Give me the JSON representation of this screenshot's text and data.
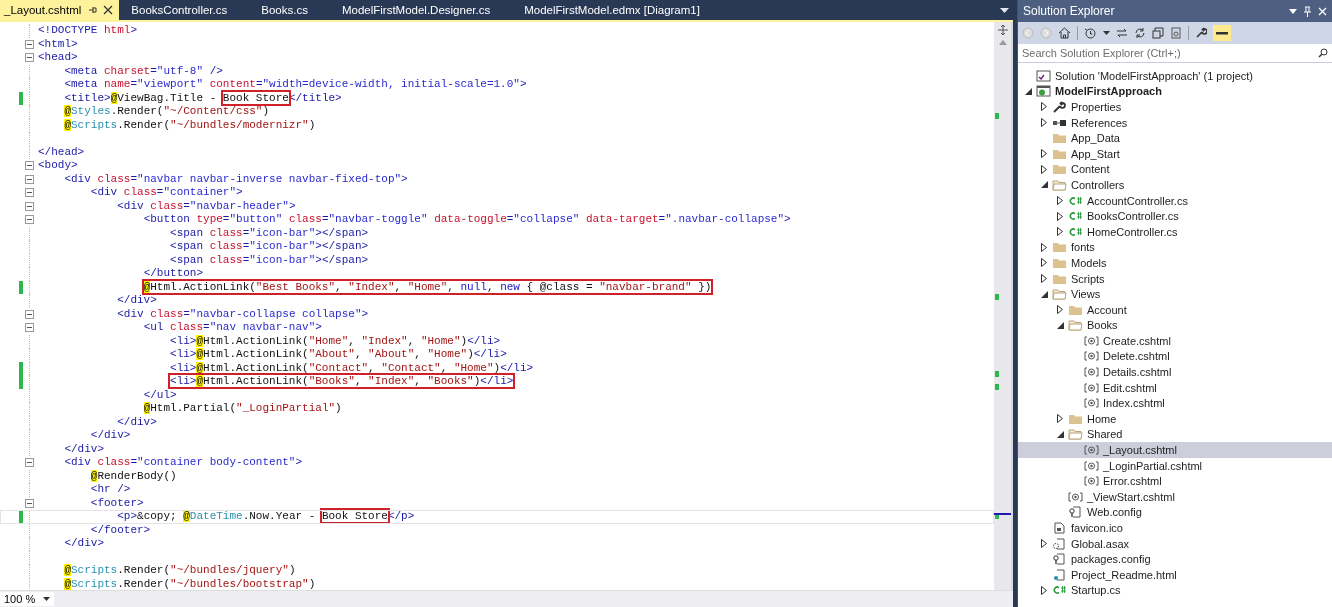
{
  "editor": {
    "tabs": [
      {
        "label": "_Layout.cshtml",
        "selected": true
      },
      {
        "label": "BooksController.cs",
        "selected": false
      },
      {
        "label": "Books.cs",
        "selected": false
      },
      {
        "label": "ModelFirstModel.Designer.cs",
        "selected": false
      },
      {
        "label": "ModelFirstModel.edmx [Diagram1]",
        "selected": false
      }
    ],
    "lines": [
      {
        "fold": false,
        "changed": false,
        "current": false,
        "segs": [
          {
            "kind": "tag",
            "text": "<!DOCTYPE "
          },
          {
            "kind": "attr",
            "text": "html"
          },
          {
            "kind": "tag",
            "text": ">"
          }
        ]
      },
      {
        "fold": true,
        "changed": false,
        "current": false,
        "segs": [
          {
            "kind": "tag",
            "text": "<html>"
          }
        ]
      },
      {
        "fold": true,
        "changed": false,
        "current": false,
        "segs": [
          {
            "kind": "tag",
            "text": "<head>"
          }
        ]
      },
      {
        "fold": false,
        "changed": false,
        "current": false,
        "segs": [
          {
            "kind": "tag",
            "text": "    <meta "
          },
          {
            "kind": "attr",
            "text": "charset"
          },
          {
            "kind": "tag",
            "text": "="
          },
          {
            "kind": "val",
            "text": "\"utf-8\""
          },
          {
            "kind": "tag",
            "text": " />"
          }
        ]
      },
      {
        "fold": false,
        "changed": false,
        "current": false,
        "segs": [
          {
            "kind": "tag",
            "text": "    <meta "
          },
          {
            "kind": "attr",
            "text": "name"
          },
          {
            "kind": "tag",
            "text": "="
          },
          {
            "kind": "val",
            "text": "\"viewport\" "
          },
          {
            "kind": "attr",
            "text": "content"
          },
          {
            "kind": "tag",
            "text": "="
          },
          {
            "kind": "val",
            "text": "\"width=device-width, initial-scale=1.0\""
          },
          {
            "kind": "tag",
            "text": ">"
          }
        ]
      },
      {
        "fold": false,
        "changed": true,
        "current": false,
        "segs": [
          {
            "kind": "tag",
            "text": "    <title>"
          },
          {
            "kind": "at",
            "text": "@"
          },
          {
            "kind": "plain",
            "text": "ViewBag.Title - "
          },
          {
            "kind": "boxed",
            "segs": [
              {
                "kind": "plain",
                "text": "Book Store"
              }
            ]
          },
          {
            "kind": "tag",
            "text": "</title>"
          }
        ]
      },
      {
        "fold": false,
        "changed": false,
        "current": false,
        "segs": [
          {
            "kind": "at",
            "text": "    @"
          },
          {
            "kind": "type",
            "text": "Styles"
          },
          {
            "kind": "plain",
            "text": ".Render("
          },
          {
            "kind": "str",
            "text": "\"~/Content/css\""
          },
          {
            "kind": "plain",
            "text": ")"
          }
        ]
      },
      {
        "fold": false,
        "changed": false,
        "current": false,
        "segs": [
          {
            "kind": "at",
            "text": "    @"
          },
          {
            "kind": "type",
            "text": "Scripts"
          },
          {
            "kind": "plain",
            "text": ".Render("
          },
          {
            "kind": "str",
            "text": "\"~/bundles/modernizr\""
          },
          {
            "kind": "plain",
            "text": ")"
          }
        ]
      },
      {
        "fold": false,
        "changed": false,
        "current": false
      },
      {
        "fold": false,
        "changed": false,
        "current": false,
        "segs": [
          {
            "kind": "tag",
            "text": "</head>"
          }
        ]
      },
      {
        "fold": true,
        "changed": false,
        "current": false,
        "segs": [
          {
            "kind": "tag",
            "text": "<body>"
          }
        ]
      },
      {
        "fold": true,
        "changed": false,
        "current": false,
        "segs": [
          {
            "kind": "tag",
            "text": "    <div "
          },
          {
            "kind": "attr",
            "text": "class"
          },
          {
            "kind": "tag",
            "text": "="
          },
          {
            "kind": "val",
            "text": "\"navbar navbar-inverse navbar-fixed-top\""
          },
          {
            "kind": "tag",
            "text": ">"
          }
        ]
      },
      {
        "fold": true,
        "changed": false,
        "current": false,
        "segs": [
          {
            "kind": "tag",
            "text": "        <div "
          },
          {
            "kind": "attr",
            "text": "class"
          },
          {
            "kind": "tag",
            "text": "="
          },
          {
            "kind": "val",
            "text": "\"container\""
          },
          {
            "kind": "tag",
            "text": ">"
          }
        ]
      },
      {
        "fold": true,
        "changed": false,
        "current": false,
        "segs": [
          {
            "kind": "tag",
            "text": "            <div "
          },
          {
            "kind": "attr",
            "text": "class"
          },
          {
            "kind": "tag",
            "text": "="
          },
          {
            "kind": "val",
            "text": "\"navbar-header\""
          },
          {
            "kind": "tag",
            "text": ">"
          }
        ]
      },
      {
        "fold": true,
        "changed": false,
        "current": false,
        "segs": [
          {
            "kind": "tag",
            "text": "                <button "
          },
          {
            "kind": "attr",
            "text": "type"
          },
          {
            "kind": "tag",
            "text": "="
          },
          {
            "kind": "val",
            "text": "\"button\" "
          },
          {
            "kind": "attr",
            "text": "class"
          },
          {
            "kind": "tag",
            "text": "="
          },
          {
            "kind": "val",
            "text": "\"navbar-toggle\" "
          },
          {
            "kind": "attr",
            "text": "data-toggle"
          },
          {
            "kind": "tag",
            "text": "="
          },
          {
            "kind": "val",
            "text": "\"collapse\" "
          },
          {
            "kind": "attr",
            "text": "data-target"
          },
          {
            "kind": "tag",
            "text": "="
          },
          {
            "kind": "val",
            "text": "\".navbar-collapse\""
          },
          {
            "kind": "tag",
            "text": ">"
          }
        ]
      },
      {
        "fold": false,
        "changed": false,
        "current": false,
        "segs": [
          {
            "kind": "tag",
            "text": "                    <span "
          },
          {
            "kind": "attr",
            "text": "class"
          },
          {
            "kind": "tag",
            "text": "="
          },
          {
            "kind": "val",
            "text": "\"icon-bar\""
          },
          {
            "kind": "tag",
            "text": "></span>"
          }
        ]
      },
      {
        "fold": false,
        "changed": false,
        "current": false,
        "segs": [
          {
            "kind": "tag",
            "text": "                    <span "
          },
          {
            "kind": "attr",
            "text": "class"
          },
          {
            "kind": "tag",
            "text": "="
          },
          {
            "kind": "val",
            "text": "\"icon-bar\""
          },
          {
            "kind": "tag",
            "text": "></span>"
          }
        ]
      },
      {
        "fold": false,
        "changed": false,
        "current": false,
        "segs": [
          {
            "kind": "tag",
            "text": "                    <span "
          },
          {
            "kind": "attr",
            "text": "class"
          },
          {
            "kind": "tag",
            "text": "="
          },
          {
            "kind": "val",
            "text": "\"icon-bar\""
          },
          {
            "kind": "tag",
            "text": "></span>"
          }
        ]
      },
      {
        "fold": false,
        "changed": false,
        "current": false,
        "segs": [
          {
            "kind": "tag",
            "text": "                </button>"
          }
        ]
      },
      {
        "fold": false,
        "changed": true,
        "current": false,
        "segs": [
          {
            "kind": "boxed",
            "segs": [
              {
                "kind": "at",
                "text": "                @"
              },
              {
                "kind": "plain",
                "text": "Html.ActionLink("
              },
              {
                "kind": "str",
                "text": "\"Best Books\""
              },
              {
                "kind": "plain",
                "text": ", "
              },
              {
                "kind": "str",
                "text": "\"Index\""
              },
              {
                "kind": "plain",
                "text": ", "
              },
              {
                "kind": "str",
                "text": "\"Home\""
              },
              {
                "kind": "plain",
                "text": ", "
              },
              {
                "kind": "kw",
                "text": "null"
              },
              {
                "kind": "plain",
                "text": ", "
              },
              {
                "kind": "kw",
                "text": "new"
              },
              {
                "kind": "plain",
                "text": " { @class = "
              },
              {
                "kind": "str",
                "text": "\"navbar-brand\""
              },
              {
                "kind": "plain",
                "text": " })"
              }
            ]
          }
        ]
      },
      {
        "fold": false,
        "changed": false,
        "current": false,
        "segs": [
          {
            "kind": "tag",
            "text": "            </div>"
          }
        ]
      },
      {
        "fold": true,
        "changed": false,
        "current": false,
        "segs": [
          {
            "kind": "tag",
            "text": "            <div "
          },
          {
            "kind": "attr",
            "text": "class"
          },
          {
            "kind": "tag",
            "text": "="
          },
          {
            "kind": "val",
            "text": "\"navbar-collapse collapse\""
          },
          {
            "kind": "tag",
            "text": ">"
          }
        ]
      },
      {
        "fold": true,
        "changed": false,
        "current": false,
        "segs": [
          {
            "kind": "tag",
            "text": "                <ul "
          },
          {
            "kind": "attr",
            "text": "class"
          },
          {
            "kind": "tag",
            "text": "="
          },
          {
            "kind": "val",
            "text": "\"nav navbar-nav\""
          },
          {
            "kind": "tag",
            "text": ">"
          }
        ]
      },
      {
        "fold": false,
        "changed": false,
        "current": false,
        "segs": [
          {
            "kind": "tag",
            "text": "                    <li>"
          },
          {
            "kind": "at",
            "text": "@"
          },
          {
            "kind": "plain",
            "text": "Html.ActionLink("
          },
          {
            "kind": "str",
            "text": "\"Home\""
          },
          {
            "kind": "plain",
            "text": ", "
          },
          {
            "kind": "str",
            "text": "\"Index\""
          },
          {
            "kind": "plain",
            "text": ", "
          },
          {
            "kind": "str",
            "text": "\"Home\""
          },
          {
            "kind": "plain",
            "text": ")"
          },
          {
            "kind": "tag",
            "text": "</li>"
          }
        ]
      },
      {
        "fold": false,
        "changed": false,
        "current": false,
        "segs": [
          {
            "kind": "tag",
            "text": "                    <li>"
          },
          {
            "kind": "at",
            "text": "@"
          },
          {
            "kind": "plain",
            "text": "Html.ActionLink("
          },
          {
            "kind": "str",
            "text": "\"About\""
          },
          {
            "kind": "plain",
            "text": ", "
          },
          {
            "kind": "str",
            "text": "\"About\""
          },
          {
            "kind": "plain",
            "text": ", "
          },
          {
            "kind": "str",
            "text": "\"Home\""
          },
          {
            "kind": "plain",
            "text": ")"
          },
          {
            "kind": "tag",
            "text": "</li>"
          }
        ]
      },
      {
        "fold": false,
        "changed": true,
        "current": false,
        "segs": [
          {
            "kind": "tag",
            "text": "                    <li>"
          },
          {
            "kind": "at",
            "text": "@"
          },
          {
            "kind": "plain",
            "text": "Html.ActionLink("
          },
          {
            "kind": "str",
            "text": "\"Contact\""
          },
          {
            "kind": "plain",
            "text": ", "
          },
          {
            "kind": "str",
            "text": "\"Contact\""
          },
          {
            "kind": "plain",
            "text": ", "
          },
          {
            "kind": "str",
            "text": "\"Home\""
          },
          {
            "kind": "plain",
            "text": ")"
          },
          {
            "kind": "tag",
            "text": "</li>"
          }
        ]
      },
      {
        "fold": false,
        "changed": true,
        "current": false,
        "segs": [
          {
            "kind": "boxed",
            "segs": [
              {
                "kind": "tag",
                "text": "                    <li>"
              },
              {
                "kind": "at",
                "text": "@"
              },
              {
                "kind": "plain",
                "text": "Html.ActionLink("
              },
              {
                "kind": "str",
                "text": "\"Books\""
              },
              {
                "kind": "plain",
                "text": ", "
              },
              {
                "kind": "str",
                "text": "\"Index\""
              },
              {
                "kind": "plain",
                "text": ", "
              },
              {
                "kind": "str",
                "text": "\"Books\""
              },
              {
                "kind": "plain",
                "text": ")"
              },
              {
                "kind": "tag",
                "text": "</li>"
              }
            ]
          }
        ]
      },
      {
        "fold": false,
        "changed": false,
        "current": false,
        "segs": [
          {
            "kind": "tag",
            "text": "                </ul>"
          }
        ]
      },
      {
        "fold": false,
        "changed": false,
        "current": false,
        "segs": [
          {
            "kind": "at",
            "text": "                @"
          },
          {
            "kind": "plain",
            "text": "Html.Partial("
          },
          {
            "kind": "str",
            "text": "\"_LoginPartial\""
          },
          {
            "kind": "plain",
            "text": ")"
          }
        ]
      },
      {
        "fold": false,
        "changed": false,
        "current": false,
        "segs": [
          {
            "kind": "tag",
            "text": "            </div>"
          }
        ]
      },
      {
        "fold": false,
        "changed": false,
        "current": false,
        "segs": [
          {
            "kind": "tag",
            "text": "        </div>"
          }
        ]
      },
      {
        "fold": false,
        "changed": false,
        "current": false,
        "segs": [
          {
            "kind": "tag",
            "text": "    </div>"
          }
        ]
      },
      {
        "fold": true,
        "changed": false,
        "current": false,
        "segs": [
          {
            "kind": "tag",
            "text": "    <div "
          },
          {
            "kind": "attr",
            "text": "class"
          },
          {
            "kind": "tag",
            "text": "="
          },
          {
            "kind": "val",
            "text": "\"container body-content\""
          },
          {
            "kind": "tag",
            "text": ">"
          }
        ]
      },
      {
        "fold": false,
        "changed": false,
        "current": false,
        "segs": [
          {
            "kind": "at",
            "text": "        @"
          },
          {
            "kind": "plain",
            "text": "RenderBody()"
          }
        ]
      },
      {
        "fold": false,
        "changed": false,
        "current": false,
        "segs": [
          {
            "kind": "tag",
            "text": "        <hr />"
          }
        ]
      },
      {
        "fold": true,
        "changed": false,
        "current": false,
        "segs": [
          {
            "kind": "tag",
            "text": "        <footer>"
          }
        ]
      },
      {
        "fold": false,
        "changed": true,
        "current": true,
        "segs": [
          {
            "kind": "tag",
            "text": "            <p>"
          },
          {
            "kind": "plain",
            "text": "&copy; "
          },
          {
            "kind": "at",
            "text": "@"
          },
          {
            "kind": "type",
            "text": "DateTime"
          },
          {
            "kind": "plain",
            "text": ".Now.Year - "
          },
          {
            "kind": "boxed",
            "segs": [
              {
                "kind": "plain",
                "text": "Book Store"
              }
            ]
          },
          {
            "kind": "tag",
            "text": "</p>"
          }
        ]
      },
      {
        "fold": false,
        "changed": false,
        "current": false,
        "segs": [
          {
            "kind": "tag",
            "text": "        </footer>"
          }
        ]
      },
      {
        "fold": false,
        "changed": false,
        "current": false,
        "segs": [
          {
            "kind": "tag",
            "text": "    </div>"
          }
        ]
      },
      {
        "fold": false,
        "changed": false,
        "current": false
      },
      {
        "fold": false,
        "changed": false,
        "current": false,
        "segs": [
          {
            "kind": "at",
            "text": "    @"
          },
          {
            "kind": "type",
            "text": "Scripts"
          },
          {
            "kind": "plain",
            "text": ".Render("
          },
          {
            "kind": "str",
            "text": "\"~/bundles/jquery\""
          },
          {
            "kind": "plain",
            "text": ")"
          }
        ]
      },
      {
        "fold": false,
        "changed": false,
        "current": false,
        "segs": [
          {
            "kind": "at",
            "text": "    @"
          },
          {
            "kind": "type",
            "text": "Scripts"
          },
          {
            "kind": "plain",
            "text": ".Render("
          },
          {
            "kind": "str",
            "text": "\"~/bundles/bootstrap\""
          },
          {
            "kind": "plain",
            "text": ")"
          }
        ]
      }
    ],
    "zoom": "100 %"
  },
  "solution_explorer": {
    "title": "Solution Explorer",
    "search": {
      "placeholder": "Search Solution Explorer (Ctrl+;)"
    },
    "items": [
      {
        "kind": "solution",
        "label": "Solution 'ModelFirstApproach' (1 project)",
        "selected": false
      },
      {
        "kind": "project",
        "label": "ModelFirstApproach",
        "selected": false,
        "expanded": true,
        "children": [
          {
            "kind": "wrench",
            "label": "Properties",
            "selected": false,
            "expanded": false
          },
          {
            "kind": "refs",
            "label": "References",
            "selected": false,
            "expanded": false
          },
          {
            "kind": "folder",
            "label": "App_Data",
            "selected": false
          },
          {
            "kind": "folder",
            "label": "App_Start",
            "selected": false,
            "expanded": false
          },
          {
            "kind": "folder",
            "label": "Content",
            "selected": false,
            "expanded": false
          },
          {
            "kind": "folder",
            "label": "Controllers",
            "selected": false,
            "expanded": true,
            "children": [
              {
                "kind": "cs",
                "label": "AccountController.cs",
                "selected": false,
                "expanded": false
              },
              {
                "kind": "cs",
                "label": "BooksController.cs",
                "selected": false,
                "expanded": false
              },
              {
                "kind": "cs",
                "label": "HomeController.cs",
                "selected": false,
                "expanded": false
              }
            ]
          },
          {
            "kind": "folder",
            "label": "fonts",
            "selected": false,
            "expanded": false
          },
          {
            "kind": "folder",
            "label": "Models",
            "selected": false,
            "expanded": false
          },
          {
            "kind": "folder",
            "label": "Scripts",
            "selected": false,
            "expanded": false
          },
          {
            "kind": "folder",
            "label": "Views",
            "selected": false,
            "expanded": true,
            "children": [
              {
                "kind": "folder",
                "label": "Account",
                "selected": false,
                "expanded": false
              },
              {
                "kind": "folder",
                "label": "Books",
                "selected": false,
                "expanded": true,
                "children": [
                  {
                    "kind": "cshtml",
                    "label": "Create.cshtml",
                    "selected": false
                  },
                  {
                    "kind": "cshtml",
                    "label": "Delete.cshtml",
                    "selected": false
                  },
                  {
                    "kind": "cshtml",
                    "label": "Details.cshtml",
                    "selected": false
                  },
                  {
                    "kind": "cshtml",
                    "label": "Edit.cshtml",
                    "selected": false
                  },
                  {
                    "kind": "cshtml",
                    "label": "Index.cshtml",
                    "selected": false
                  }
                ]
              },
              {
                "kind": "folder",
                "label": "Home",
                "selected": false,
                "expanded": false
              },
              {
                "kind": "folder",
                "label": "Shared",
                "selected": false,
                "expanded": true,
                "children": [
                  {
                    "kind": "cshtml",
                    "label": "_Layout.cshtml",
                    "selected": true
                  },
                  {
                    "kind": "cshtml",
                    "label": "_LoginPartial.cshtml",
                    "selected": false
                  },
                  {
                    "kind": "cshtml",
                    "label": "Error.cshtml",
                    "selected": false
                  }
                ]
              },
              {
                "kind": "cshtml",
                "label": "_ViewStart.cshtml",
                "selected": false
              },
              {
                "kind": "config",
                "label": "Web.config",
                "selected": false
              }
            ]
          },
          {
            "kind": "ico",
            "label": "favicon.ico",
            "selected": false
          },
          {
            "kind": "asax",
            "label": "Global.asax",
            "selected": false,
            "expanded": false
          },
          {
            "kind": "config",
            "label": "packages.config",
            "selected": false
          },
          {
            "kind": "html",
            "label": "Project_Readme.html",
            "selected": false
          },
          {
            "kind": "cs",
            "label": "Startup.cs",
            "selected": false,
            "expanded": false
          }
        ]
      }
    ]
  }
}
